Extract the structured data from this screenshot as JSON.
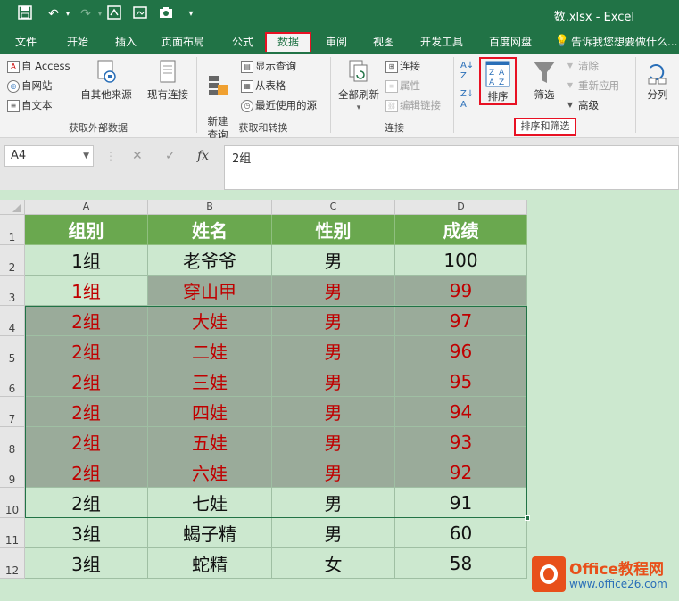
{
  "titlebar": {
    "title": "数.xlsx - Excel",
    "qa_icons": [
      "save-icon",
      "undo-icon",
      "redo-icon",
      "form-icon",
      "image-icon",
      "camera-icon",
      "customize-icon"
    ]
  },
  "tabs": [
    "文件",
    "开始",
    "插入",
    "页面布局",
    "公式",
    "数据",
    "审阅",
    "视图",
    "开发工具",
    "百度网盘",
    "告诉我您想要做什么..."
  ],
  "active_tab": "数据",
  "ribbon": {
    "get_external": {
      "access": "自 Access",
      "web": "自网站",
      "text": "自文本",
      "other": "自其他来源",
      "existing": "现有连接",
      "label": "获取外部数据"
    },
    "get_transform": {
      "new_query": "新建\n查询",
      "show_query": "显示查询",
      "from_table": "从表格",
      "recent": "最近使用的源",
      "label": "获取和转换"
    },
    "connections": {
      "refresh_all": "全部刷新",
      "connections": "连接",
      "properties": "属性",
      "edit_links": "编辑链接",
      "label": "连接"
    },
    "sort_filter": {
      "sort": "排序",
      "filter": "筛选",
      "clear": "清除",
      "reapply": "重新应用",
      "advanced": "高级",
      "label": "排序和筛选"
    },
    "data_tools": {
      "split": "分列"
    }
  },
  "formula_bar": {
    "cell_ref": "A4",
    "cancel": "✕",
    "confirm": "✓",
    "fx": "fx",
    "value": "2组"
  },
  "grid": {
    "columns": [
      "A",
      "B",
      "C",
      "D"
    ],
    "row_numbers": [
      "1",
      "2",
      "3",
      "4",
      "5",
      "6",
      "7",
      "8",
      "9",
      "10",
      "11",
      "12"
    ],
    "header": [
      "组别",
      "姓名",
      "性别",
      "成绩"
    ],
    "rows": [
      [
        "1组",
        "老爷爷",
        "男",
        "100"
      ],
      [
        "1组",
        "穿山甲",
        "男",
        "99"
      ],
      [
        "2组",
        "大娃",
        "男",
        "97"
      ],
      [
        "2组",
        "二娃",
        "男",
        "96"
      ],
      [
        "2组",
        "三娃",
        "男",
        "95"
      ],
      [
        "2组",
        "四娃",
        "男",
        "94"
      ],
      [
        "2组",
        "五娃",
        "男",
        "93"
      ],
      [
        "2组",
        "六娃",
        "男",
        "92"
      ],
      [
        "2组",
        "七娃",
        "男",
        "91"
      ],
      [
        "3组",
        "蝎子精",
        "男",
        "60"
      ],
      [
        "3组",
        "蛇精",
        "女",
        "58"
      ]
    ],
    "selected_rows": [
      3,
      4,
      5,
      6,
      7,
      8,
      9
    ]
  },
  "watermark": {
    "title": "Office教程网",
    "url": "www.office26.com"
  },
  "colors": {
    "excel_green": "#217346",
    "header_fill": "#6aa84f",
    "sheet_bg": "#cce8cf",
    "selection_fill": "#9aab9a",
    "selected_text": "#c00000",
    "highlight_red": "#e81123"
  }
}
